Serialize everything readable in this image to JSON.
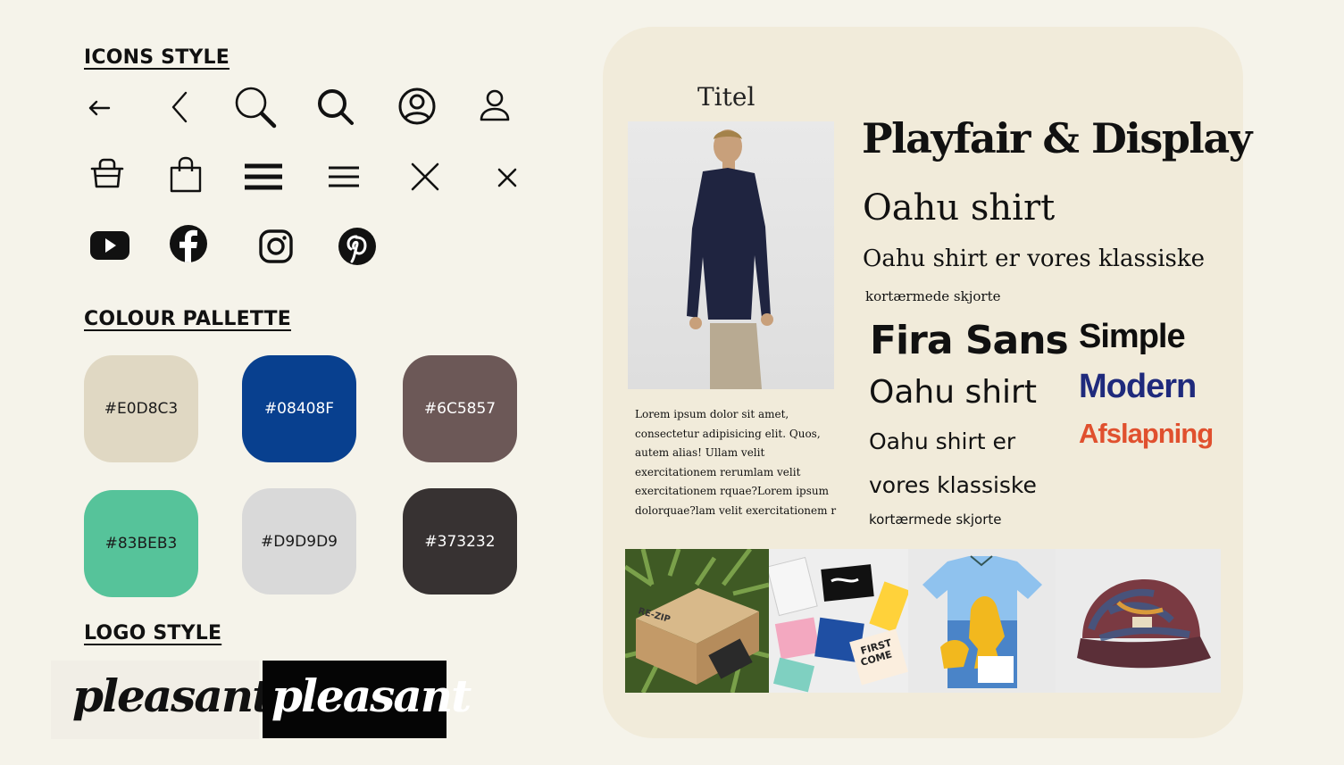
{
  "sections": {
    "icons_title": "ICONS STYLE",
    "palette_title": "COLOUR PALLETTE",
    "logo_title": "LOGO STYLE"
  },
  "icons": [
    "arrow-left-icon",
    "chevron-left-icon",
    "search-icon",
    "search-bold-icon",
    "user-circle-icon",
    "user-icon",
    "basket-icon",
    "shopping-bag-icon",
    "menu-bold-icon",
    "menu-icon",
    "close-icon",
    "close-small-icon",
    "youtube-icon",
    "facebook-icon",
    "instagram-icon",
    "pinterest-icon"
  ],
  "palette": [
    {
      "label": "#E0D8C3",
      "color": "#E0D8C3"
    },
    {
      "label": "#08408F",
      "color": "#08408F"
    },
    {
      "label": "#6C5857",
      "color": "#6C5857"
    },
    {
      "label": "#83BEB3",
      "color": "#56C39A"
    },
    {
      "label": "#D9D9D9",
      "color": "#D9D9D9"
    },
    {
      "label": "#373232",
      "color": "#373232"
    }
  ],
  "logo": {
    "text": "pleasant"
  },
  "board": {
    "titel": "Titel",
    "playfair_title": "Playfair & Display",
    "playfair_h2": "Oahu shirt",
    "playfair_h3": "Oahu shirt er vores klassiske",
    "playfair_small": "kortærmede skjorte",
    "fira_title": "Fira Sans",
    "fira_h2": "Oahu shirt",
    "fira_h3a": "Oahu shirt er",
    "fira_h3b": "vores klassiske",
    "fira_small": "kortærmede skjorte",
    "word_simple": "Simple",
    "word_modern": "Modern",
    "word_afslapning": "Afslapning",
    "lorem": [
      "Lorem ipsum dolor sit amet,",
      "consectetur adipisicing elit. Quos,",
      "autem alias! Ullam velit",
      "exercitationem rerumlam velit",
      "exercitationem rquae?Lorem ipsum",
      "dolorquae?lam velit exercitationem r"
    ],
    "box_label": "RE-ZIP",
    "tag_first": "FIRST",
    "tag_come": "COME"
  }
}
